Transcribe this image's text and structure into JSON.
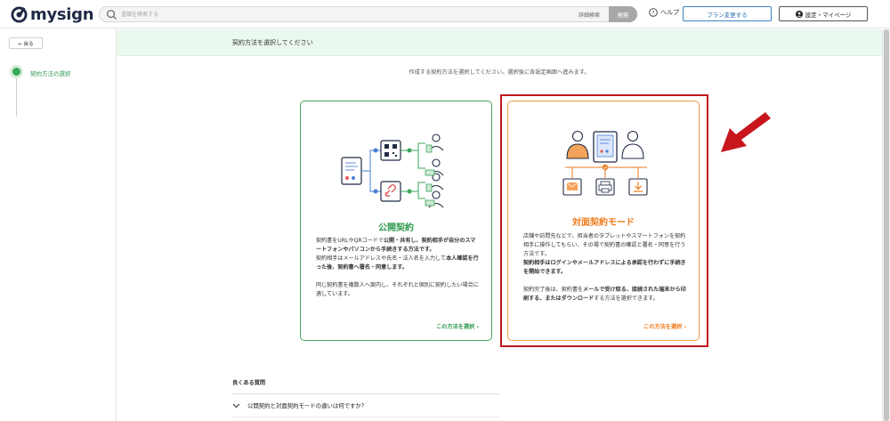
{
  "header": {
    "logo_text": "mysign",
    "search_placeholder": "書類を検索する",
    "advanced_search": "詳細検索",
    "search_button": "検索",
    "help": "ヘルプ",
    "plan_button": "プラン変更する",
    "settings_button": "設定・マイページ"
  },
  "sidebar": {
    "back_button": "← 戻る",
    "steps": [
      {
        "label": "契約方法の選択"
      }
    ]
  },
  "banner": {
    "title": "契約方法を選択してください"
  },
  "instruction": "作成する契約方法を選択してください。選択後に各設定画面へ進みます。",
  "cards": {
    "public": {
      "title": "公開契約",
      "desc1_a": "契約書をURLやQRコードで",
      "desc1_b": "公開・共有し、契約相手が自分のスマートフォンやパソコンから手続きする方法です。",
      "desc2_a": "契約相手はメールアドレスや氏名・法人名を入力して",
      "desc2_b": "本人確認を行った後、契約書へ署名・同意します。",
      "desc3": "同じ契約書を複数人へ案内し、それぞれと個別に契約したい場合に適しています。",
      "link": "この方法を選択 ›"
    },
    "face": {
      "title": "対面契約モード",
      "desc1": "店舗や訪問先などで、担当者のタブレットやスマートフォンを契約相手に操作してもらい、その場で契約書の確認と署名・同意を行う方法です。",
      "desc2": "契約相手はログインやメールアドレスによる承認を行わずに手続きを開始できます。",
      "desc3_a": "契約完了後は、契約書を",
      "desc3_b": "メールで受け取る、接続された端末から印刷する、またはダウンロード",
      "desc3_c": "する方法を選択できます。",
      "link": "この方法を選択 ›"
    }
  },
  "faq": {
    "title": "良くある質問",
    "items": [
      {
        "question": "公開契約と対面契約モードの違いは何ですか？"
      }
    ]
  },
  "colors": {
    "green": "#2f9a4f",
    "orange": "#ef7a1a",
    "highlight_red": "#c0171f",
    "navy": "#1f2a44"
  }
}
